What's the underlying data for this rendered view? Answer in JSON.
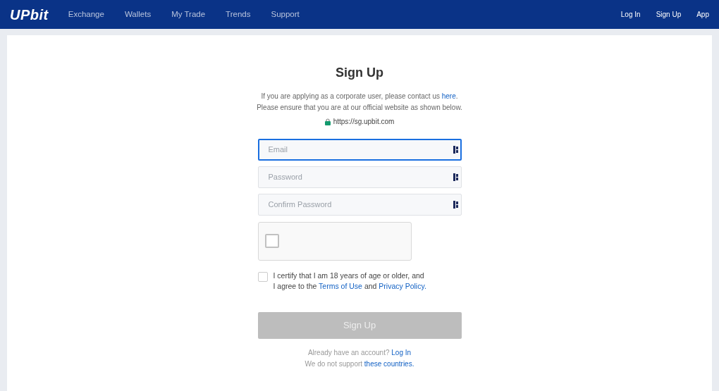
{
  "navbar": {
    "logo": "UPbit",
    "menu": [
      {
        "label": "Exchange"
      },
      {
        "label": "Wallets"
      },
      {
        "label": "My Trade"
      },
      {
        "label": "Trends"
      },
      {
        "label": "Support"
      }
    ],
    "account_links": [
      {
        "label": "Log In"
      },
      {
        "label": "Sign Up"
      },
      {
        "label": "App"
      }
    ]
  },
  "signup": {
    "title": "Sign Up",
    "corporate_notice": {
      "text": "If you are applying as a corporate user, please contact us ",
      "link": "here",
      "after": "."
    },
    "official_notice": "Please ensure that you are at our official website as shown below.",
    "official_url": "https://sg.upbit.com",
    "fields": [
      {
        "placeholder": "Email",
        "focused": true
      },
      {
        "placeholder": "Password",
        "focused": false
      },
      {
        "placeholder": "Confirm Password",
        "focused": false
      }
    ],
    "captcha": {
      "checked": false
    },
    "agreement": {
      "checked": false,
      "line_1": "I certify that I am 18 years of age or older, and",
      "line_2_before": "I agree to the ",
      "terms_link": "Terms of Use",
      "line_2_middle": " and ",
      "privacy_link": "Privacy Policy."
    },
    "submit": {
      "label": "Sign Up",
      "disabled": true
    },
    "login_prompt": {
      "text": "Already have an account? ",
      "link": "Log In"
    },
    "countries_notice": {
      "text": "We do not support ",
      "link": "these countries."
    }
  }
}
